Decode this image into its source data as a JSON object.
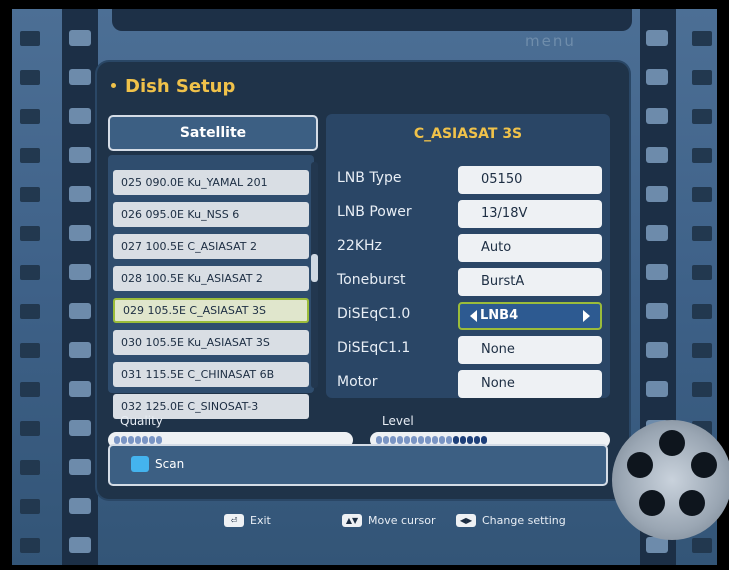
{
  "menu_logo": "menu",
  "title": "Dish Setup",
  "satellite_header": "Satellite",
  "satellite_list": [
    "025 090.0E Ku_YAMAL 201",
    "026 095.0E Ku_NSS 6",
    "027 100.5E C_ASIASAT 2",
    "028 100.5E Ku_ASIASAT 2",
    "029 105.5E C_ASIASAT 3S",
    "030 105.5E Ku_ASIASAT 3S",
    "031 115.5E C_CHINASAT 6B",
    "032 125.0E C_SINOSAT-3"
  ],
  "selected_satellite_index": 4,
  "settings_title": "C_ASIASAT 3S",
  "settings": [
    {
      "label": "LNB Type",
      "value": "05150"
    },
    {
      "label": "LNB Power",
      "value": "13/18V"
    },
    {
      "label": "22KHz",
      "value": "Auto"
    },
    {
      "label": "Toneburst",
      "value": "BurstA"
    },
    {
      "label": "DiSEqC1.0",
      "value": "LNB4"
    },
    {
      "label": "DiSEqC1.1",
      "value": "None"
    },
    {
      "label": "Motor",
      "value": "None"
    }
  ],
  "active_setting_index": 4,
  "quality": {
    "label": "Quality",
    "segments": 7,
    "dark_segments": 0
  },
  "level": {
    "label": "Level",
    "segments": 16,
    "dark_segments": 5
  },
  "scan": {
    "label": "Scan",
    "key_color": "#44b3ee"
  },
  "footer": [
    {
      "key_icon": "exit-key-icon",
      "key_text": "⏎",
      "label": "Exit"
    },
    {
      "key_icon": "updown-key-icon",
      "key_text": "▲▼",
      "label": "Move cursor"
    },
    {
      "key_icon": "leftright-key-icon",
      "key_text": "◀▶",
      "label": "Change setting"
    }
  ],
  "colors": {
    "title": "#f0c24a",
    "selection_border": "#9bbc3a",
    "active_value_bg": "#2d5a91"
  }
}
